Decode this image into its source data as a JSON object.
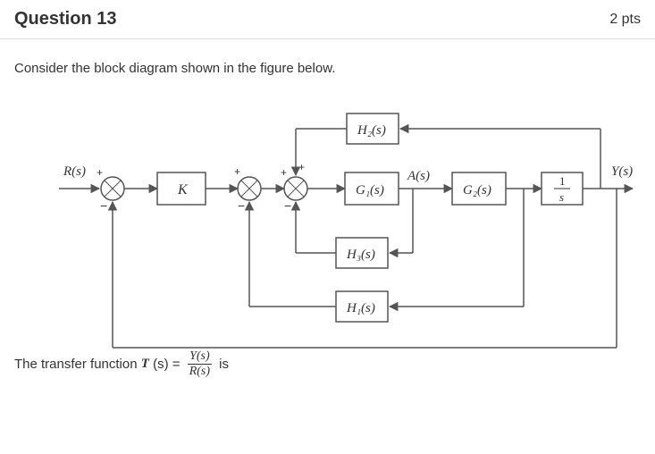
{
  "header": {
    "title": "Question 13",
    "points": "2 pts"
  },
  "prompt": "Consider the block diagram shown in the figure below.",
  "diagram": {
    "input": "R(s)",
    "output": "Y(s)",
    "blocks": {
      "K": "K",
      "H2": "H₂(s)",
      "G1": "G₁(s)",
      "A": "A(s)",
      "G2": "G₂(s)",
      "integrator_num": "1",
      "integrator_den": "s",
      "H3": "H₃(s)",
      "H1": "H₁(s)"
    },
    "sum_signs": {
      "plus": "+",
      "minus": "−"
    }
  },
  "transfer_function": {
    "prefix": "The transfer function ",
    "T": "T",
    "args": " (s) = ",
    "num": "Y(s)",
    "den": "R(s)",
    "suffix": " is"
  }
}
